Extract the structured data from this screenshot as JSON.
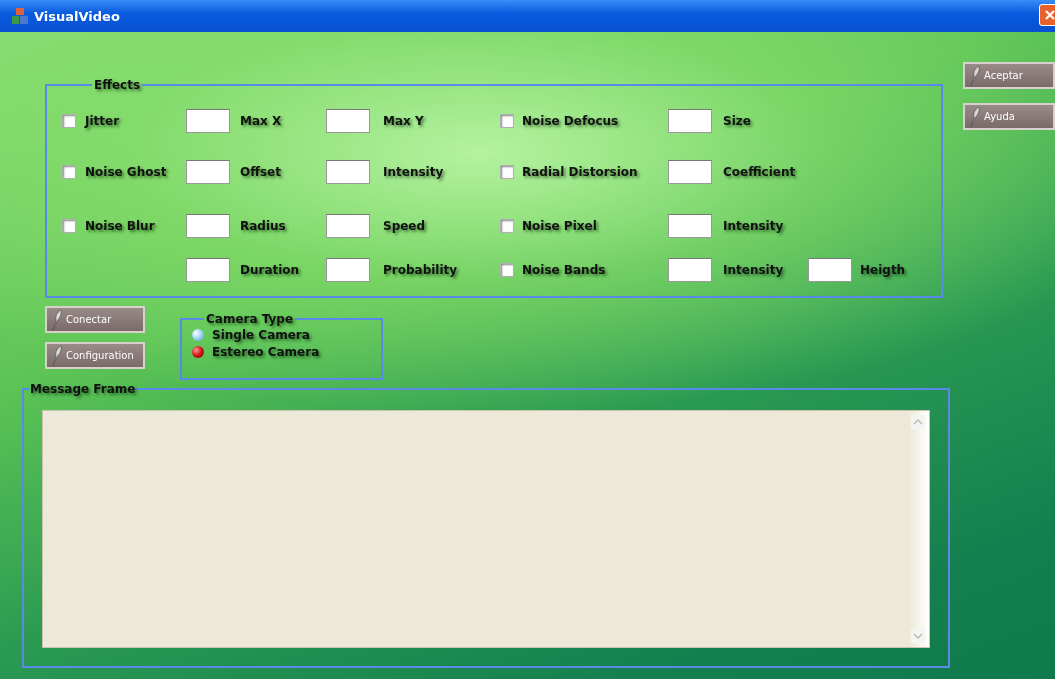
{
  "window": {
    "title": "VisualVideo"
  },
  "effects": {
    "title": "Effects",
    "rows": [
      {
        "left": {
          "label": "Jitter",
          "checked": false
        },
        "left_params": [
          "Max X",
          "Max Y"
        ],
        "right": {
          "label": "Noise Defocus",
          "checked": false
        },
        "right_params": [
          "Size"
        ]
      },
      {
        "left": {
          "label": "Noise Ghost",
          "checked": false
        },
        "left_params": [
          "Offset",
          "Intensity"
        ],
        "right": {
          "label": "Radial Distorsion",
          "checked": false
        },
        "right_params": [
          "Coefficient"
        ]
      },
      {
        "left": {
          "label": "Noise Blur",
          "checked": false
        },
        "left_params": [
          "Radius",
          "Speed"
        ],
        "right": {
          "label": "Noise Pixel",
          "checked": false
        },
        "right_params": [
          "Intensity"
        ]
      },
      {
        "left_params": [
          "Duration",
          "Probability"
        ],
        "right": {
          "label": "Noise Bands",
          "checked": false
        },
        "right_params": [
          "Intensity",
          "Heigth"
        ]
      }
    ]
  },
  "side_buttons": [
    "Aceptar",
    "Ayuda"
  ],
  "left_buttons": [
    "Conectar",
    "Configuration"
  ],
  "camera_type": {
    "title": "Camera Type",
    "options": [
      {
        "label": "Single Camera",
        "selected": false
      },
      {
        "label": "Estereo Camera",
        "selected": true
      }
    ]
  },
  "message_frame": {
    "title": "Message Frame"
  }
}
